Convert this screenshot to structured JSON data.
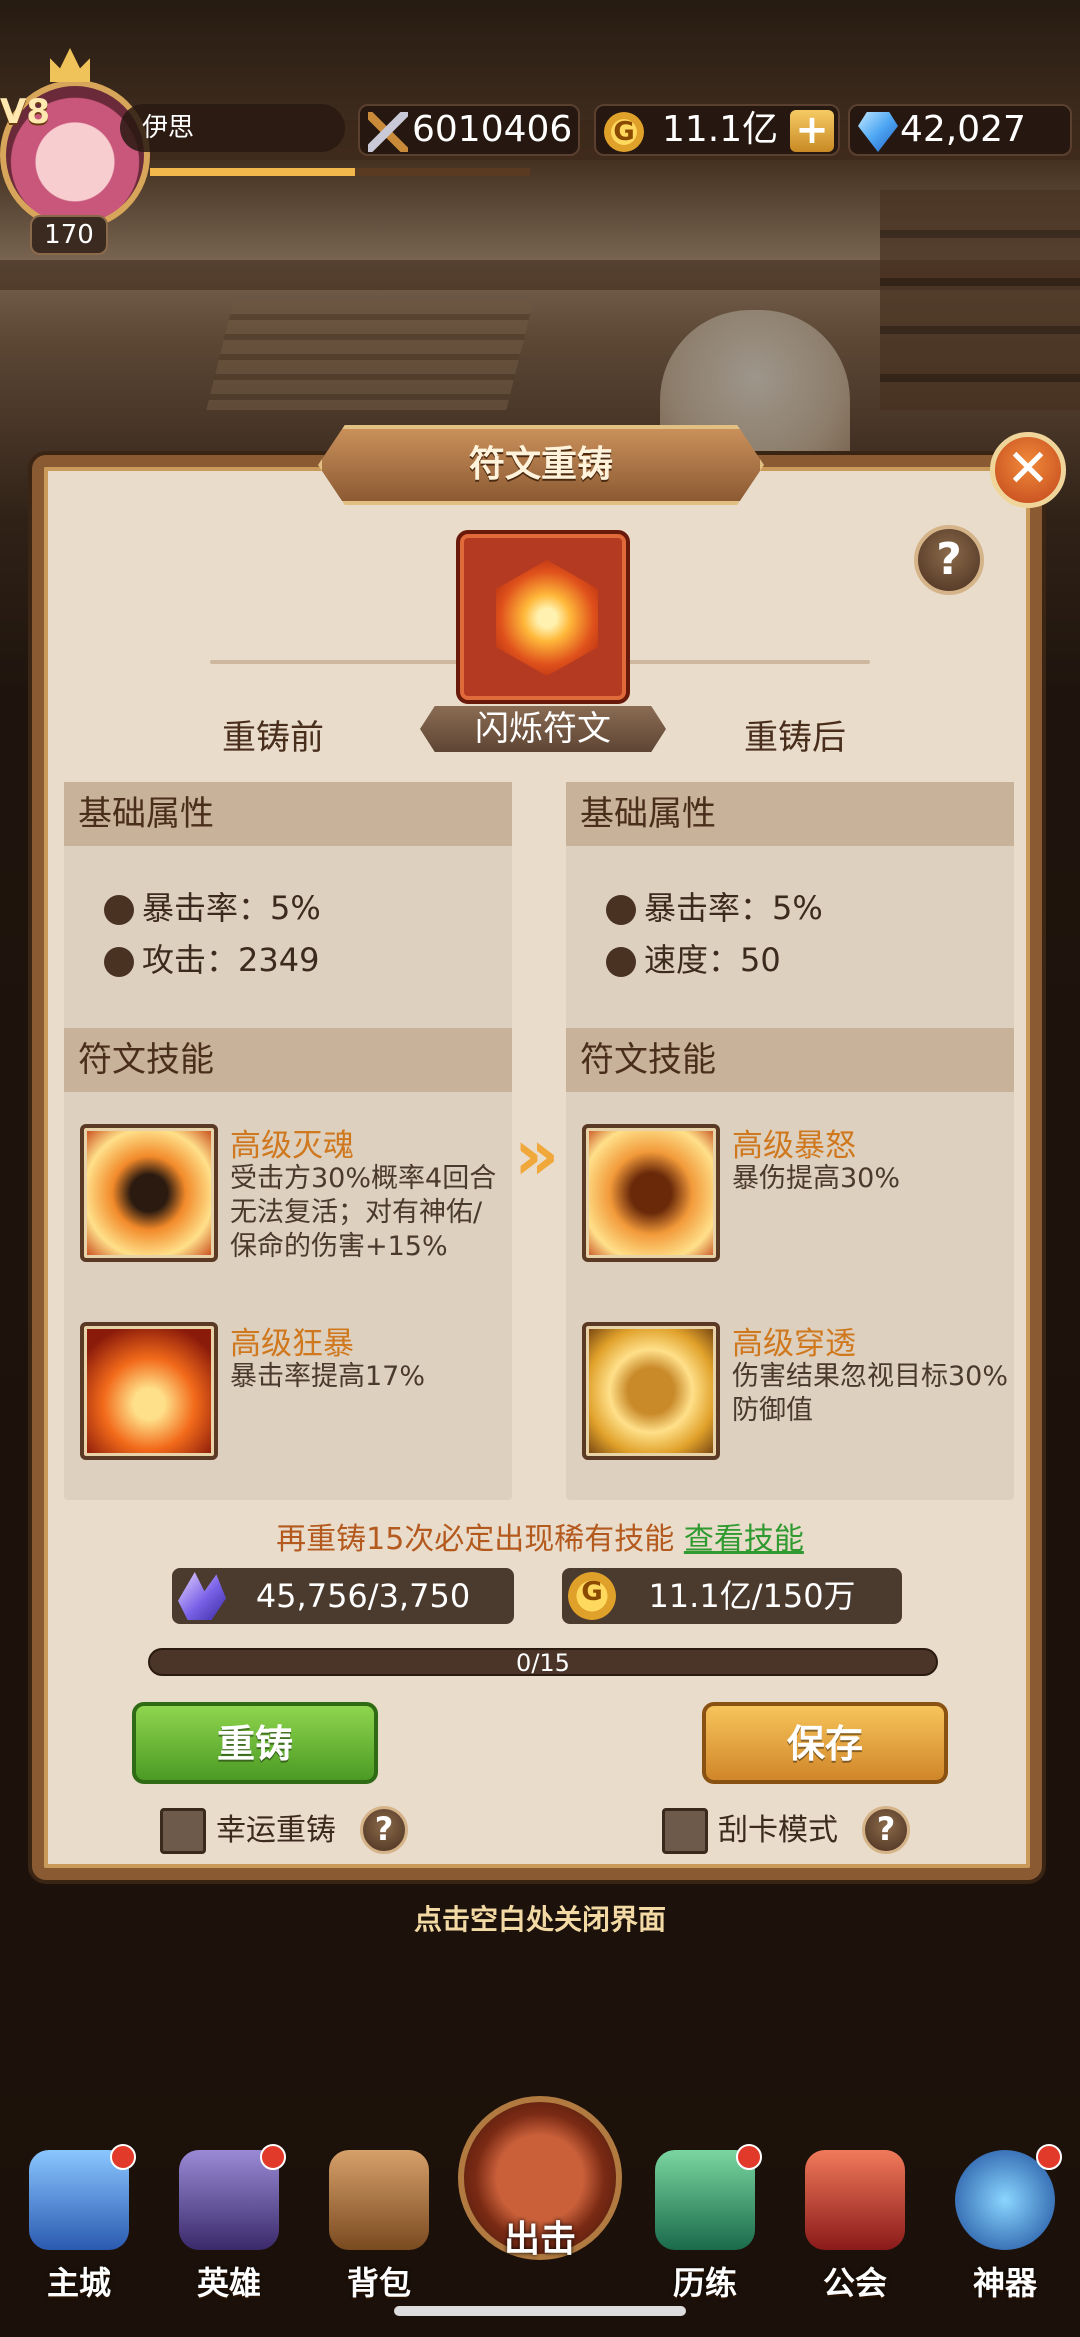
{
  "player": {
    "vip": "V8",
    "level": "170",
    "name": "伊思",
    "exp_progress": 0.54
  },
  "resources": {
    "power": "6010406",
    "gold": "11.1亿",
    "gold_icon": "G",
    "diamonds": "42,027",
    "plus": "+"
  },
  "dialog": {
    "title": "符文重铸",
    "close": "✕",
    "help": "?",
    "rune_name": "闪烁符文",
    "before_label": "重铸前",
    "after_label": "重铸后",
    "before": {
      "attr_header": "基础属性",
      "stats": [
        "暴击率：5%",
        "攻击：2349"
      ],
      "skill_header": "符文技能",
      "skills": [
        {
          "name": "高级灭魂",
          "desc": "受击方30%概率4回合无法复活；对有神佑/保命的伤害+15%"
        },
        {
          "name": "高级狂暴",
          "desc": "暴击率提高17%"
        }
      ]
    },
    "after": {
      "attr_header": "基础属性",
      "stats": [
        "暴击率：5%",
        "速度：50"
      ],
      "skill_header": "符文技能",
      "skills": [
        {
          "name": "高级暴怒",
          "desc": "暴伤提高30%"
        },
        {
          "name": "高级穿透",
          "desc": "伤害结果忽视目标30%防御值"
        }
      ]
    },
    "arrow": "»",
    "rare_hint": "再重铸15次必定出现稀有技能",
    "view_skills": "查看技能",
    "cost_crystal": "45,756/3,750",
    "cost_gold": "11.1亿/150万",
    "progress_text": "0/15",
    "progress_value": 0,
    "reforge_button": "重铸",
    "save_button": "保存",
    "lucky_reforge": "幸运重铸",
    "scratch_mode": "刮卡模式"
  },
  "close_hint": "点击空白处关闭界面",
  "nav": {
    "items": [
      "主城",
      "英雄",
      "背包",
      "出击",
      "历练",
      "公会",
      "神器"
    ]
  },
  "colors": {
    "accent_orange": "#d0781e",
    "link_green": "#2f9a2f",
    "reforge_green": "#4b9a24",
    "save_gold": "#d0862a"
  }
}
